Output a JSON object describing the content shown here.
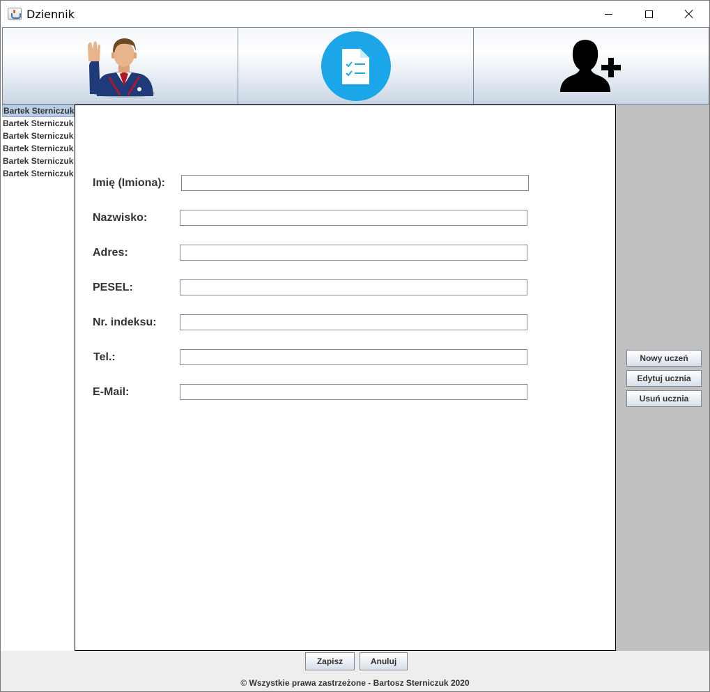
{
  "window": {
    "title": "Dziennik"
  },
  "toolbar": {
    "buttons": [
      {
        "icon": "student-raising-hand-icon"
      },
      {
        "icon": "grade-sheet-icon"
      },
      {
        "icon": "add-user-icon"
      }
    ]
  },
  "students": [
    "Bartek Sterniczuk",
    "Bartek Sterniczuk",
    "Bartek Sterniczuk",
    "Bartek Sterniczuk",
    "Bartek Sterniczuk",
    "Bartek Sterniczuk"
  ],
  "form": {
    "fields": [
      {
        "label": "Imię (Imiona):",
        "value": ""
      },
      {
        "label": "Nazwisko:",
        "value": ""
      },
      {
        "label": "Adres:",
        "value": ""
      },
      {
        "label": "PESEL:",
        "value": ""
      },
      {
        "label": "Nr. indeksu:",
        "value": ""
      },
      {
        "label": "Tel.:",
        "value": ""
      },
      {
        "label": "E-Mail:",
        "value": ""
      }
    ]
  },
  "side_buttons": {
    "new_student": "Nowy uczeń",
    "edit_student": "Edytuj ucznia",
    "delete_student": "Usuń ucznia"
  },
  "bottom": {
    "save": "Zapisz",
    "cancel": "Anuluj",
    "copyright": "© Wszystkie prawa zastrzeżone - Bartosz Sterniczuk 2020"
  },
  "colors": {
    "panel_grey": "#c0c0c0",
    "icon_blue": "#1aa6e8",
    "selection": "#b8cfe5"
  }
}
